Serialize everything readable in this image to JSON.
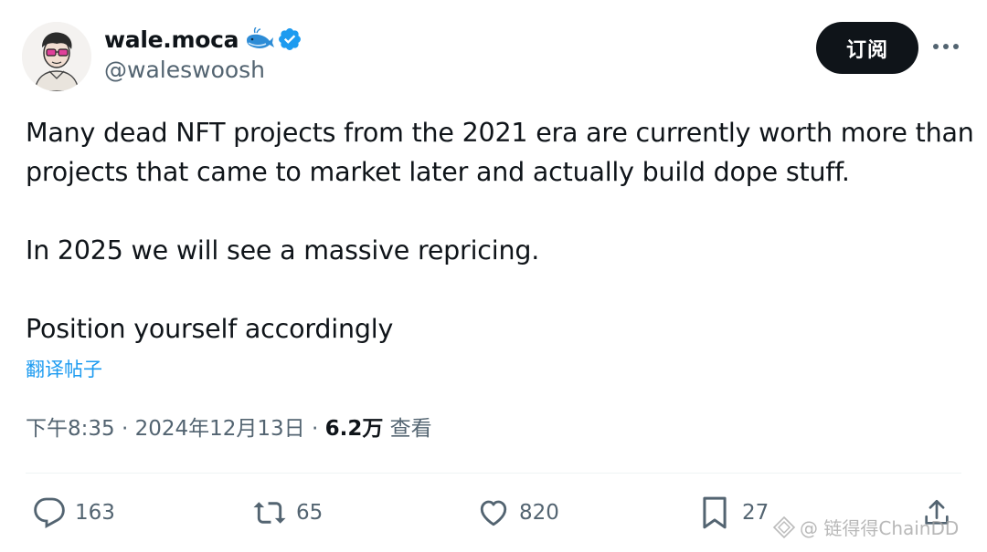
{
  "author": {
    "display_name": "wale.moca",
    "handle": "@waleswoosh"
  },
  "header": {
    "subscribe_label": "订阅",
    "more_icon": "more-horizontal-icon"
  },
  "post": {
    "lines": [
      "Many dead NFT projects from the 2021 era are currently worth more than",
      "projects that came to market later and actually build dope stuff.",
      "In 2025 we will see a massive repricing.",
      "Position yourself accordingly"
    ],
    "translate_label": "翻译帖子"
  },
  "meta": {
    "time": "下午8:35",
    "separator": " · ",
    "date": "2024年12月13日",
    "views_count": "6.2万",
    "views_label": " 查看"
  },
  "actions": {
    "replies": "163",
    "reposts": "65",
    "likes": "820",
    "bookmarks": "27"
  },
  "watermark": {
    "text": "@ 链得得ChainDD"
  },
  "colors": {
    "text": "#0f1419",
    "secondary": "#536471",
    "accent": "#1d9bf0",
    "button": "#0f1419"
  }
}
